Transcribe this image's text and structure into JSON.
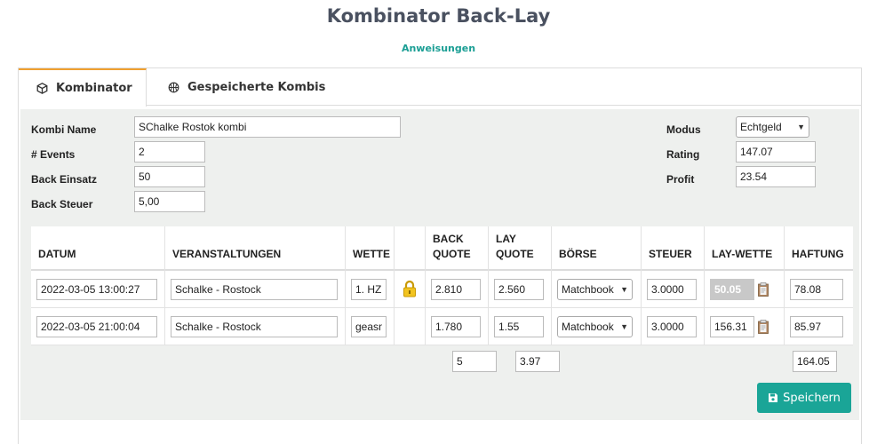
{
  "page": {
    "title": "Kombinator Back-Lay",
    "instructions_link": "Anweisungen"
  },
  "tabs": [
    {
      "label": "Kombinator",
      "icon": "cube-icon",
      "active": true
    },
    {
      "label": "Gespeicherte Kombis",
      "icon": "basketball-icon",
      "active": false
    }
  ],
  "form": {
    "kombi_name_label": "Kombi Name",
    "kombi_name_value": "SChalke Rostok kombi",
    "events_label": "# Events",
    "events_value": "2",
    "back_einsatz_label": "Back Einsatz",
    "back_einsatz_value": "50",
    "back_steuer_label": "Back Steuer",
    "back_steuer_value": "5,00",
    "modus_label": "Modus",
    "modus_value": "Echtgeld",
    "rating_label": "Rating",
    "rating_value": "147.07",
    "profit_label": "Profit",
    "profit_value": "23.54"
  },
  "table": {
    "headers": [
      "DATUM",
      "VERANSTALTUNGEN",
      "WETTE",
      "",
      "BACK QUOTE",
      "LAY QUOTE",
      "BÖRSE",
      "STEUER",
      "LAY-WETTE",
      "HAFTUNG"
    ],
    "rows": [
      {
        "datum": "2022-03-05 13:00:27",
        "veranstaltung": "Schalke - Rostock",
        "wette": "1. HZ",
        "locked": true,
        "back_quote": "2.810",
        "lay_quote": "2.560",
        "boerse": "Matchbook",
        "steuer": "3.0000",
        "lay_wette": "50.05",
        "haftung": "78.08"
      },
      {
        "datum": "2022-03-05 21:00:04",
        "veranstaltung": "Schalke - Rostock",
        "wette": "geasn",
        "locked": false,
        "back_quote": "1.780",
        "lay_quote": "1.55",
        "boerse": "Matchbook",
        "steuer": "3.0000",
        "lay_wette": "156.31",
        "haftung": "85.97"
      }
    ],
    "totals": {
      "back_quote": "5",
      "lay_quote": "3.97",
      "haftung": "164.05"
    }
  },
  "save_label": "Speichern",
  "colors": {
    "accent": "#1aa597",
    "tab_active_border": "#f0a030",
    "panel_bg": "#eef0ee",
    "title": "#4a5160"
  }
}
